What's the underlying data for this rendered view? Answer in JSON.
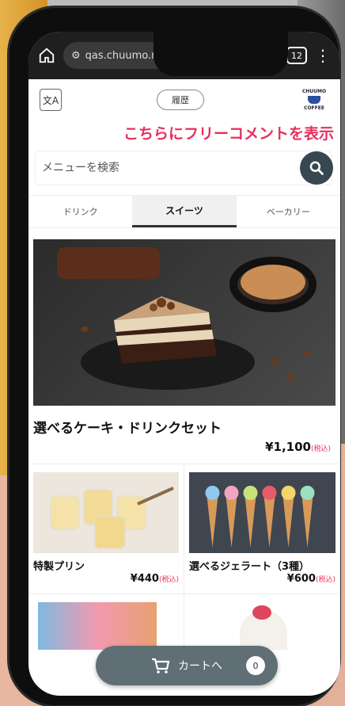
{
  "browser": {
    "url": "qas.chuumo.net/Mobile/",
    "tab_count": "12"
  },
  "header": {
    "history_label": "履歴",
    "logo_top": "CHUUMO",
    "logo_bottom": "COFFEE"
  },
  "marquee_text": "こちらにフリーコメントを表示",
  "search": {
    "placeholder": "メニューを検索"
  },
  "category_tabs": [
    "ドリンク",
    "スイーツ",
    "ベーカリー"
  ],
  "active_tab": "スイーツ",
  "featured": {
    "name": "選べるケーキ・ドリンクセット",
    "price": "¥1,100",
    "tax_label": "(税込)"
  },
  "products": [
    {
      "name": "特製プリン",
      "price": "¥440",
      "tax_label": "(税込)"
    },
    {
      "name": "選べるジェラート（3種）",
      "price": "¥600",
      "tax_label": "(税込)"
    }
  ],
  "cart": {
    "label": "カートへ",
    "count": "0"
  },
  "colors": {
    "accent_text": "#e8305c",
    "cart_button": "#5f6f75",
    "search_button": "#37474f"
  }
}
